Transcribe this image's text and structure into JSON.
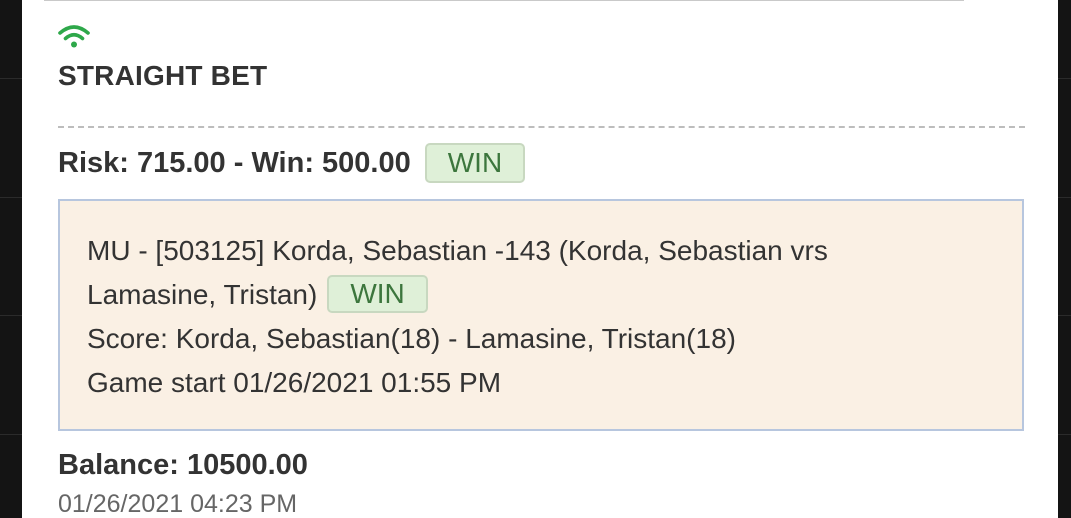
{
  "bet": {
    "type_label": "STRAIGHT BET",
    "risk_win": "Risk: 715.00 - Win: 500.00",
    "status": "WIN"
  },
  "wager": {
    "line1": "MU - [503125] Korda, Sebastian -143 (Korda, Sebastian vrs",
    "line2": "Lamasine, Tristan)",
    "status": "WIN",
    "score": "Score: Korda, Sebastian(18) - Lamasine, Tristan(18)",
    "game_start": "Game start 01/26/2021 01:55 PM"
  },
  "footer": {
    "balance": "Balance: 10500.00",
    "timestamp": "01/26/2021 04:23 PM"
  },
  "icons": {
    "connection": "wifi-icon"
  },
  "colors": {
    "connection_icon": "#2ea84a",
    "win_badge_bg": "#dff0d8",
    "win_badge_text": "#3c763d",
    "detail_bg": "#faf0e4",
    "detail_border": "#b7c6de"
  }
}
